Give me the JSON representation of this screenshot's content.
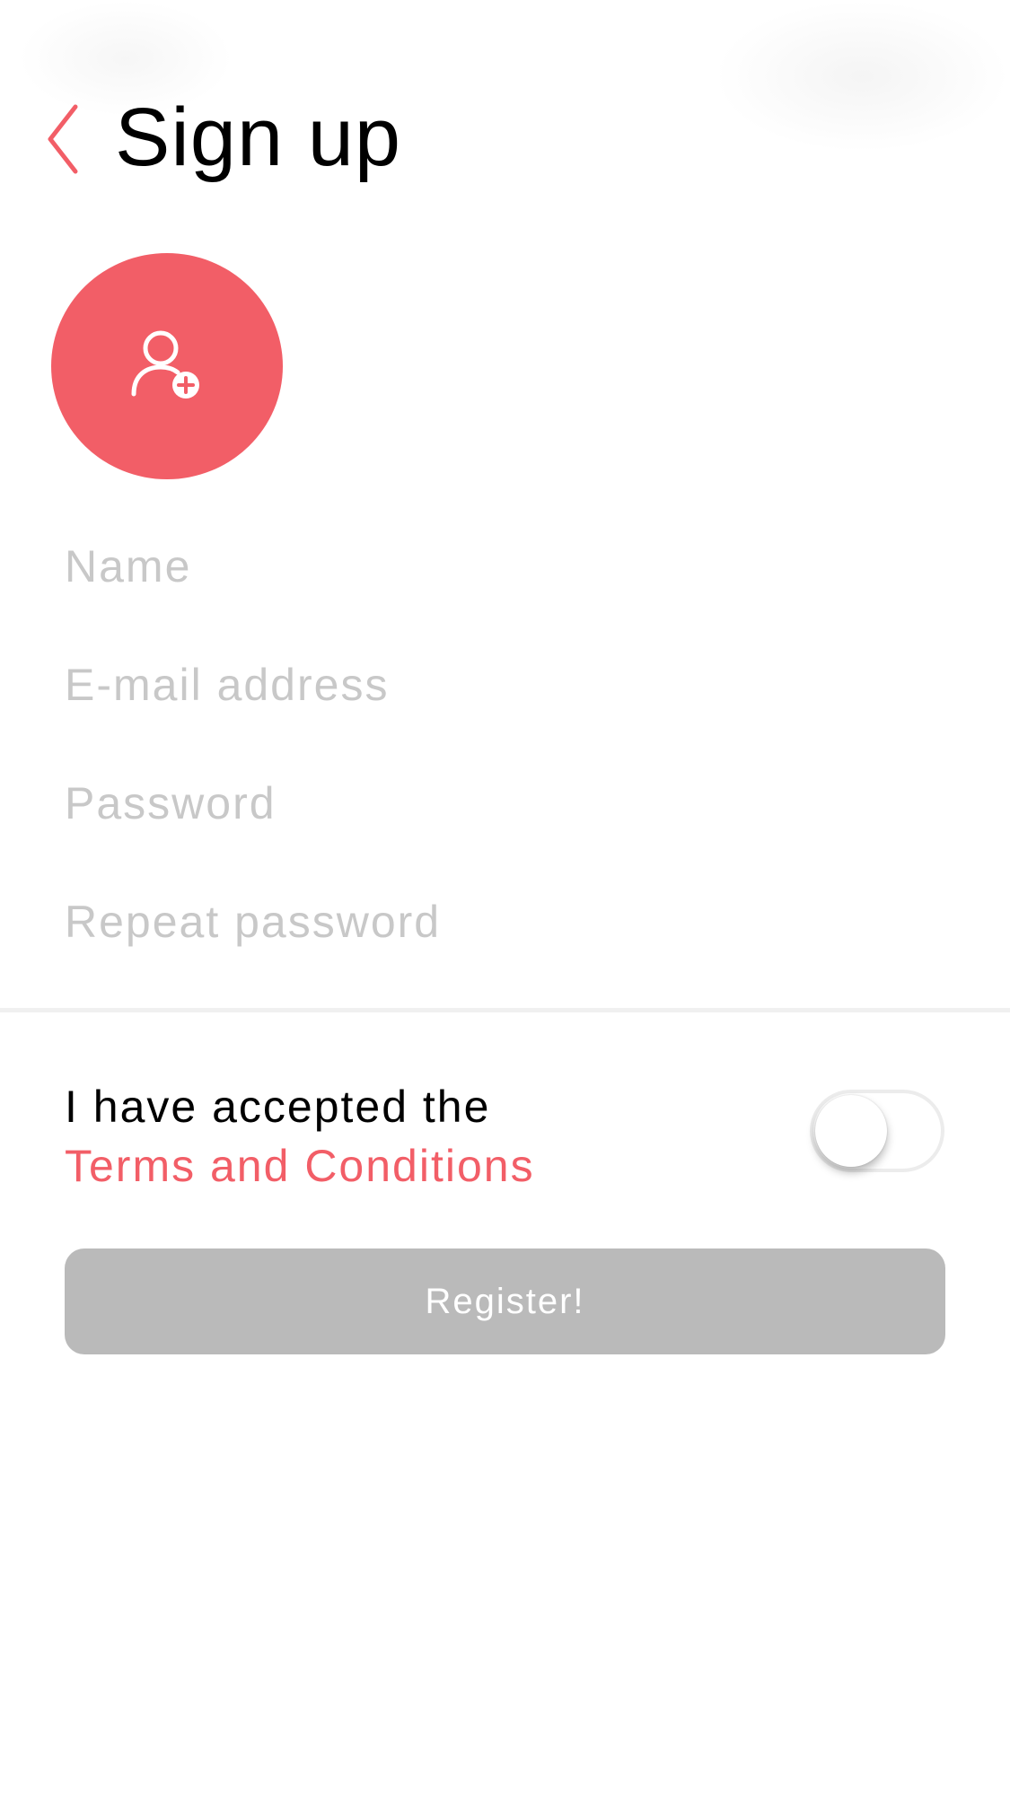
{
  "header": {
    "title": "Sign up",
    "back_icon": "chevron-left-icon"
  },
  "avatar": {
    "icon": "add-user-icon",
    "color": "#f25e67"
  },
  "form": {
    "name_placeholder": "Name",
    "email_placeholder": "E-mail address",
    "password_placeholder": "Password",
    "repeat_password_placeholder": "Repeat password"
  },
  "terms": {
    "text": "I have accepted the",
    "link_label": "Terms and Conditions",
    "accepted": false
  },
  "register": {
    "label": "Register!",
    "enabled": false
  },
  "colors": {
    "accent": "#f25e67",
    "placeholder": "#c8c8c8",
    "disabled_button": "#bababa"
  }
}
